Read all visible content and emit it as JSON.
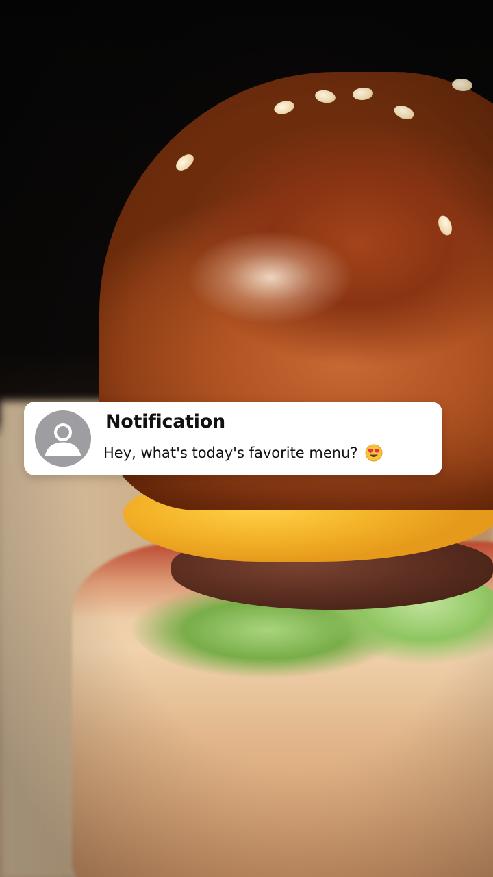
{
  "background": {
    "subject": "burger-photo"
  },
  "notification": {
    "title": "Notification",
    "message": "Hey, what's today's favorite menu?",
    "avatar_icon": "person-icon",
    "emoji_icon": "heart-eyes-emoji-icon",
    "colors": {
      "card": "#ffffff",
      "avatar": "#9e9ea2",
      "text": "#111111"
    }
  }
}
